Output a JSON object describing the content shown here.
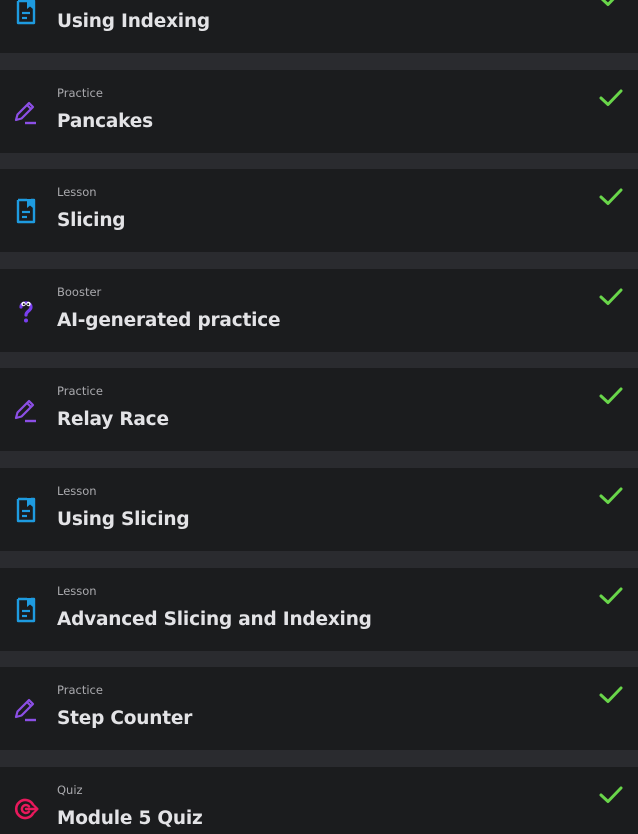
{
  "colors": {
    "background": "#2a2b2f",
    "row": "#1b1c1e",
    "lesson": "#1e9be0",
    "practice": "#8c4fe6",
    "booster": "#7a3ff0",
    "quiz": "#e8195c",
    "check": "#69d64a"
  },
  "items": [
    {
      "kind": "",
      "title": "Using Indexing",
      "icon": "lesson-doc-icon",
      "completed": true
    },
    {
      "kind": "Practice",
      "title": "Pancakes",
      "icon": "pencil-icon",
      "completed": true
    },
    {
      "kind": "Lesson",
      "title": "Slicing",
      "icon": "lesson-doc-icon",
      "completed": true
    },
    {
      "kind": "Booster",
      "title": "AI-generated practice",
      "icon": "question-mascot-icon",
      "completed": true
    },
    {
      "kind": "Practice",
      "title": "Relay Race",
      "icon": "pencil-icon",
      "completed": true
    },
    {
      "kind": "Lesson",
      "title": "Using Slicing",
      "icon": "lesson-doc-icon",
      "completed": true
    },
    {
      "kind": "Lesson",
      "title": "Advanced Slicing and Indexing",
      "icon": "lesson-doc-icon",
      "completed": true
    },
    {
      "kind": "Practice",
      "title": "Step Counter",
      "icon": "pencil-icon",
      "completed": true
    },
    {
      "kind": "Quiz",
      "title": "Module 5 Quiz",
      "icon": "target-icon",
      "completed": true
    }
  ]
}
